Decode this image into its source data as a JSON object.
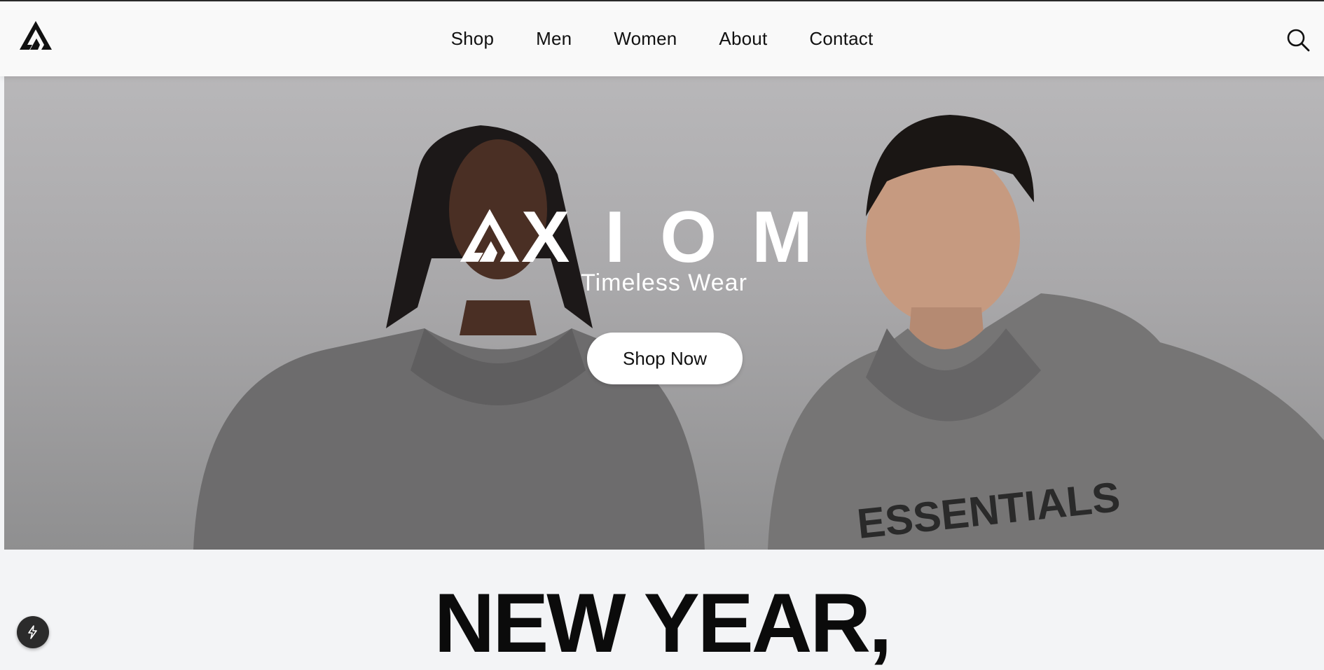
{
  "brand": {
    "logo_icon": "axiom-logo-icon",
    "wordmark": "XIOM",
    "tagline": "Timeless Wear"
  },
  "nav": {
    "items": [
      {
        "label": "Shop"
      },
      {
        "label": "Men"
      },
      {
        "label": "Women"
      },
      {
        "label": "About"
      },
      {
        "label": "Contact"
      }
    ],
    "search_icon": "search-icon"
  },
  "hero": {
    "cta_label": "Shop Now",
    "hoodie_text": "ESSENTIALS"
  },
  "section": {
    "headline": "NEW YEAR,"
  },
  "fab": {
    "icon": "lightning-icon"
  },
  "colors": {
    "header_bg": "#f9f9f9",
    "page_bg": "#f3f4f6",
    "cta_bg": "#ffffff",
    "text_dark": "#111111"
  }
}
